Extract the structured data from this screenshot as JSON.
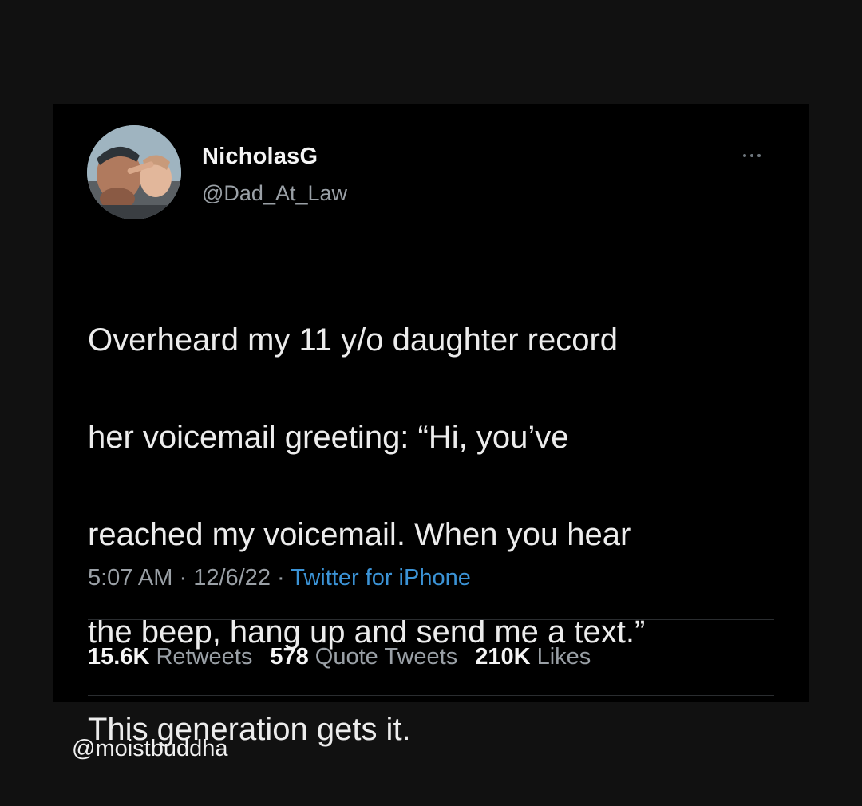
{
  "tweet": {
    "author": {
      "display_name": "NicholasG",
      "handle": "@Dad_At_Law"
    },
    "text_lines": [
      "Overheard my 11 y/o daughter record",
      "her voicemail greeting: “Hi, you’ve",
      "reached my voicemail. When you hear",
      "the beep, hang up and send me a text.”",
      "This generation gets it."
    ],
    "meta": {
      "time": "5:07 AM",
      "separator": " · ",
      "date": "12/6/22",
      "source": "Twitter for iPhone"
    },
    "stats": {
      "retweets_count": "15.6K",
      "retweets_label": "Retweets",
      "quotes_count": "578",
      "quotes_label": "Quote Tweets",
      "likes_count": "210K",
      "likes_label": "Likes"
    },
    "more_icon": "ellipsis-icon"
  },
  "watermark": "@moistbuddha",
  "colors": {
    "background": "#111111",
    "card": "#000000",
    "link": "#3b93d6",
    "muted": "#9aa0a6"
  }
}
